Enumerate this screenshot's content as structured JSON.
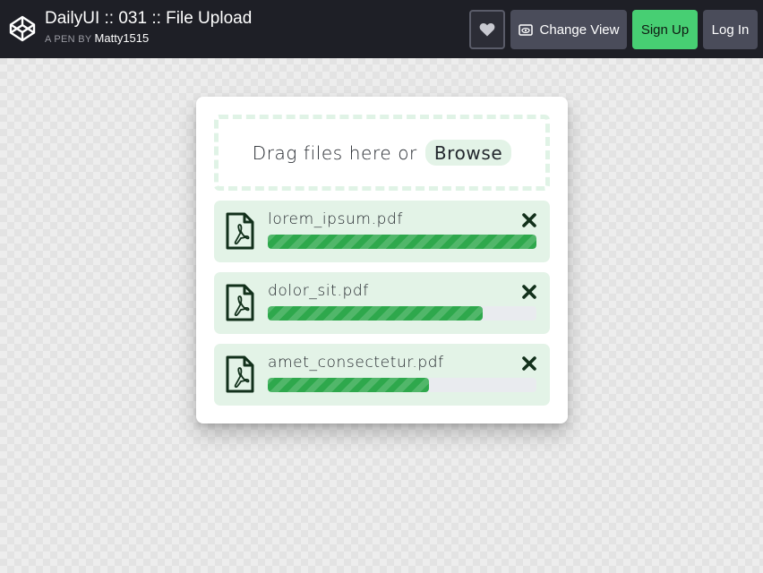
{
  "header": {
    "pen_title": "DailyUI :: 031 :: File Upload",
    "by_label": "A PEN BY",
    "author": "Matty1515",
    "logo_icon": "codepen-logo-icon",
    "buttons": {
      "heart_icon": "heart-icon",
      "change_view_icon": "eye-window-icon",
      "change_view_label": "Change View",
      "sign_up_label": "Sign Up",
      "log_in_label": "Log In"
    }
  },
  "uploader": {
    "drop_prompt": "Drag files here or",
    "browse_label": "Browse",
    "files": [
      {
        "name": "lorem_ipsum.pdf",
        "progress": 1.0,
        "icon": "pdf-file-icon",
        "remove_icon": "close-icon"
      },
      {
        "name": "dolor_sit.pdf",
        "progress": 0.8,
        "icon": "pdf-file-icon",
        "remove_icon": "close-icon"
      },
      {
        "name": "amet_consectetur.pdf",
        "progress": 0.6,
        "icon": "pdf-file-icon",
        "remove_icon": "close-icon"
      }
    ]
  },
  "colors": {
    "topbar_bg": "#1e1f26",
    "accent_green": "#47cf73",
    "progress_green": "#2ea84c",
    "item_bg": "#e3f3e7",
    "icon_dark": "#12301b"
  }
}
